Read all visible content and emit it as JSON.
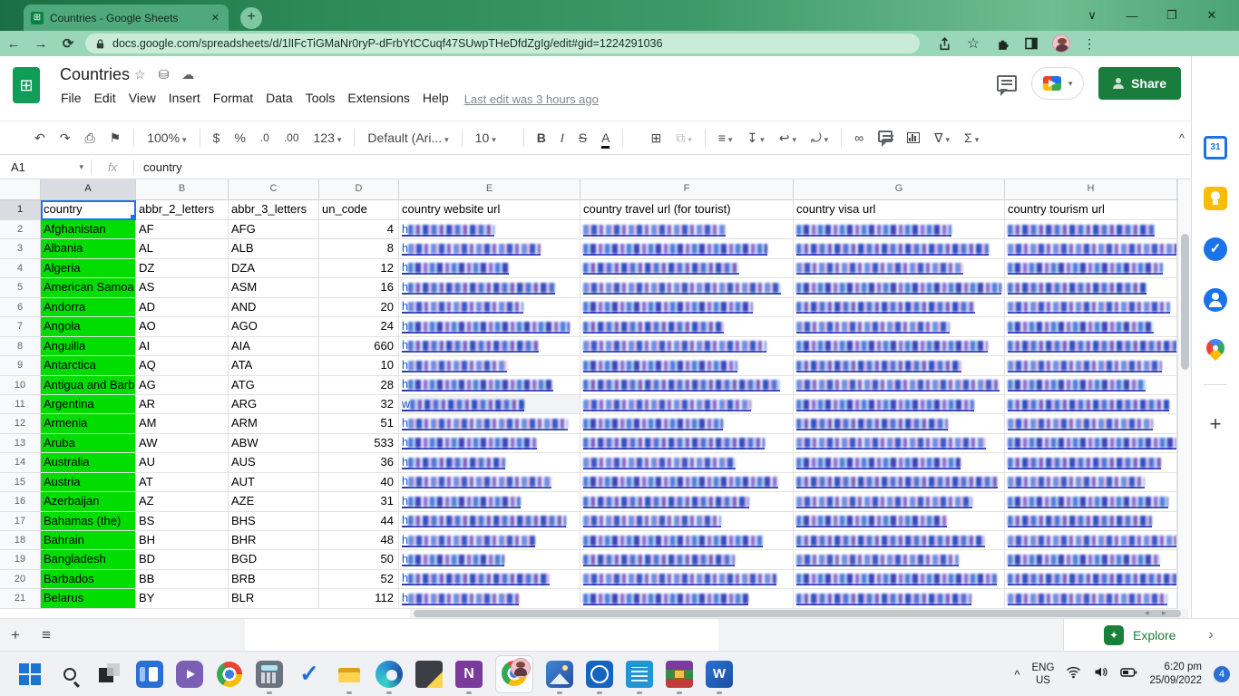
{
  "browser": {
    "tab_title": "Countries - Google Sheets",
    "url": "docs.google.com/spreadsheets/d/1lIFcTiGMaNr0ryP-dFrbYtCCuqf47SUwpTHeDfdZgIg/edit#gid=1224291036"
  },
  "icons": {
    "tabchev": "∨",
    "min": "—",
    "restore": "❐",
    "close": "✕",
    "back": "←",
    "fwd": "→",
    "reload": "⟳",
    "star": "☆",
    "dots": "⋮",
    "grid": "⊞",
    "cloud": "☁",
    "folder": "⛁",
    "undo": "↶",
    "redo": "↷",
    "print": "⎙",
    "paint": "⚑",
    "dollar": "$",
    "percent": "%",
    "dec0": ".0",
    "dec00": ".00",
    "fmt123": "123",
    "bold": "B",
    "italic": "I",
    "strike": "S",
    "color": "A",
    "borders": "⊞",
    "merge": "⧉",
    "halign": "≡",
    "valign": "↧",
    "wrap": "↩",
    "rotate": "⤾",
    "link": "∞",
    "sigma": "Σ",
    "filter": "∇",
    "caret": "▾",
    "collapse": "^",
    "plus": "+",
    "menu": "≡",
    "chevr": "›",
    "explore_star": "✦",
    "chevup": "^",
    "hsarrows": "◂ ▸",
    "check": "✓",
    "n_letter": "N",
    "w_letter": "W",
    "fx": "fx"
  },
  "sheets": {
    "title": "Countries",
    "menus": [
      "File",
      "Edit",
      "View",
      "Insert",
      "Format",
      "Data",
      "Tools",
      "Extensions",
      "Help"
    ],
    "last_edit": "Last edit was 3 hours ago",
    "share_label": "Share",
    "toolbar": {
      "zoom": "100%",
      "font": "Default (Ari...",
      "size": "10"
    },
    "name_box": "A1",
    "formula_value": "country",
    "explore_label": "Explore"
  },
  "grid": {
    "col_letters": [
      "A",
      "B",
      "C",
      "D",
      "E",
      "F",
      "G",
      "H"
    ],
    "header_row": [
      "country",
      "abbr_2_letters",
      "abbr_3_letters",
      "un_code",
      "country website url",
      "country travel url (for tourist)",
      "country visa url",
      "country tourism url"
    ],
    "rows": [
      {
        "country": "Afghanistan",
        "a2": "AF",
        "a3": "AFG",
        "un": "4",
        "p": "h"
      },
      {
        "country": "Albania",
        "a2": "AL",
        "a3": "ALB",
        "un": "8",
        "p": "h"
      },
      {
        "country": "Algeria",
        "a2": "DZ",
        "a3": "DZA",
        "un": "12",
        "p": "h"
      },
      {
        "country": "American Samoa",
        "a2": "AS",
        "a3": "ASM",
        "un": "16",
        "p": "h"
      },
      {
        "country": "Andorra",
        "a2": "AD",
        "a3": "AND",
        "un": "20",
        "p": "h"
      },
      {
        "country": "Angola",
        "a2": "AO",
        "a3": "AGO",
        "un": "24",
        "p": "h"
      },
      {
        "country": "Anguilla",
        "a2": "AI",
        "a3": "AIA",
        "un": "660",
        "p": "h"
      },
      {
        "country": "Antarctica",
        "a2": "AQ",
        "a3": "ATA",
        "un": "10",
        "p": "h"
      },
      {
        "country": "Antigua and Barbuda",
        "a2": "AG",
        "a3": "ATG",
        "un": "28",
        "p": "h"
      },
      {
        "country": "Argentina",
        "a2": "AR",
        "a3": "ARG",
        "un": "32",
        "p": "w",
        "shade": true
      },
      {
        "country": "Armenia",
        "a2": "AM",
        "a3": "ARM",
        "un": "51",
        "p": "h"
      },
      {
        "country": "Aruba",
        "a2": "AW",
        "a3": "ABW",
        "un": "533",
        "p": "h"
      },
      {
        "country": "Australia",
        "a2": "AU",
        "a3": "AUS",
        "un": "36",
        "p": "h"
      },
      {
        "country": "Austria",
        "a2": "AT",
        "a3": "AUT",
        "un": "40",
        "p": "h"
      },
      {
        "country": "Azerbaijan",
        "a2": "AZ",
        "a3": "AZE",
        "un": "31",
        "p": "h"
      },
      {
        "country": "Bahamas (the)",
        "a2": "BS",
        "a3": "BHS",
        "un": "44",
        "p": "h"
      },
      {
        "country": "Bahrain",
        "a2": "BH",
        "a3": "BHR",
        "un": "48",
        "p": "h"
      },
      {
        "country": "Bangladesh",
        "a2": "BD",
        "a3": "BGD",
        "un": "50",
        "p": "h"
      },
      {
        "country": "Barbados",
        "a2": "BB",
        "a3": "BRB",
        "un": "52",
        "p": "h"
      },
      {
        "country": "Belarus",
        "a2": "BY",
        "a3": "BLR",
        "un": "112",
        "p": "h"
      }
    ]
  },
  "sidebar_icons": [
    "calendar-icon",
    "keep-icon",
    "tasks-icon",
    "contacts-icon",
    "maps-icon"
  ],
  "sidebar": {
    "calendar_day": "31"
  },
  "taskbar": {
    "icons": [
      "start",
      "search",
      "taskview",
      "widgets",
      "chat",
      "chrome",
      "calculator",
      "todo",
      "explorer",
      "edge",
      "notes",
      "onenote",
      "chrome-active",
      "photos",
      "clock",
      "notepad",
      "winrar",
      "word"
    ],
    "dotted": [
      "calculator",
      "explorer",
      "edge",
      "onenote",
      "photos",
      "clock",
      "notepad",
      "winrar",
      "word"
    ],
    "lang_line1": "ENG",
    "lang_line2": "US",
    "time": "6:20 pm",
    "date": "25/09/2022",
    "badge": "4"
  },
  "colors": {
    "green_cell": "#01dc01",
    "share_green": "#1a7d3d",
    "link_blue": "#1155cc",
    "selection_blue": "#1a73e8",
    "tab_green": "#4fa97c"
  }
}
